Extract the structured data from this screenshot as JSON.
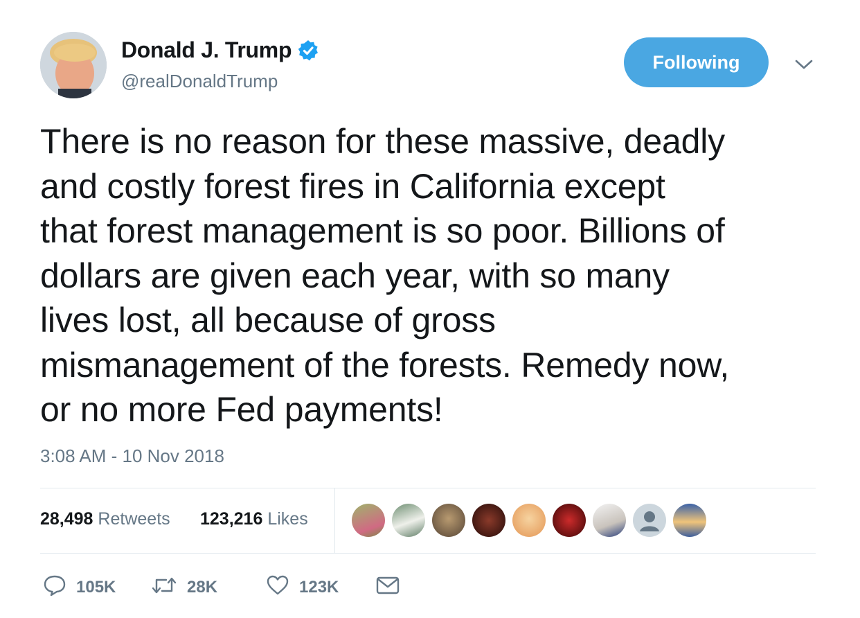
{
  "user": {
    "name": "Donald J. Trump",
    "handle": "@realDonaldTrump",
    "verified": true
  },
  "follow_button": {
    "label": "Following"
  },
  "tweet": {
    "text": "There is no reason for these massive, deadly\nand costly forest fires in California except\nthat forest management is so poor. Billions of\ndollars are given each year, with so many\nlives lost, all because of gross\nmismanagement of the forests. Remedy now,\nor no more Fed payments!",
    "timestamp": "3:08 AM - 10 Nov 2018"
  },
  "stats": {
    "retweets_count": "28,498",
    "retweets_label": "Retweets",
    "likes_count": "123,216",
    "likes_label": "Likes"
  },
  "actions": {
    "reply_count": "105K",
    "retweet_count": "28K",
    "like_count": "123K"
  },
  "colors": {
    "accent": "#4aa7e2",
    "text_primary": "#14171a",
    "text_secondary": "#657786",
    "border": "#e1e8ed"
  },
  "icons": [
    "verified-badge-icon",
    "chevron-down-icon",
    "reply-icon",
    "retweet-icon",
    "heart-icon",
    "mail-icon"
  ]
}
